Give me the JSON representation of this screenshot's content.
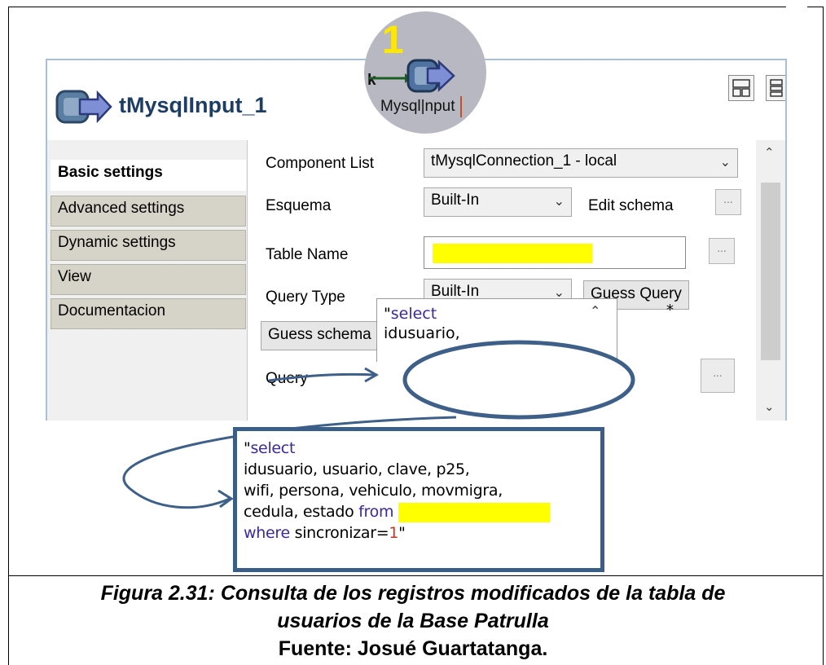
{
  "component": {
    "title": "tMysqlInput_1"
  },
  "zoom_badge": {
    "number": "1",
    "link_letter": "k",
    "label": "Mysql|nput"
  },
  "tabs": [
    {
      "label": "Basic settings",
      "active": true
    },
    {
      "label": "Advanced settings",
      "active": false
    },
    {
      "label": "Dynamic settings",
      "active": false
    },
    {
      "label": "View",
      "active": false
    },
    {
      "label": "Documentacion",
      "active": false
    }
  ],
  "basic_settings": {
    "component_list_label": "Component List",
    "component_list_value": "tMysqlConnection_1 - local",
    "esquema_label": "Esquema",
    "esquema_value": "Built-In",
    "edit_schema_label": "Edit schema",
    "table_name_label": "Table Name",
    "query_type_label": "Query Type",
    "query_type_value": "Built-In",
    "guess_query_label": "Guess Query",
    "guess_schema_label": "Guess schema",
    "query_label": "Query",
    "query_line1": "\"",
    "query_line1_kw": "select",
    "query_line2": "idusuario,",
    "dirty_marker": "*",
    "dots_label": "..."
  },
  "callout": {
    "line1_quote": "\"",
    "line1_kw": "select",
    "line2": "idusuario, usuario, clave, p25,",
    "line3": "wifi, persona, vehiculo, movmigra,",
    "line4_a": "cedula, estado ",
    "line4_kw": "from",
    "line5_kw": "where",
    "line5_b": " sincronizar=",
    "line5_num": "1",
    "line5_c": "\""
  },
  "caption": {
    "line1": "Figura 2.31: Consulta de los registros modificados de la tabla de",
    "line2": "usuarios de la Base Patrulla",
    "line3": "Fuente: Josué Guartatanga."
  },
  "colors": {
    "highlight": "#ffff00",
    "keyword": "#3b2a9a",
    "callout_border": "#3b5e86",
    "title": "#1c3d64"
  }
}
